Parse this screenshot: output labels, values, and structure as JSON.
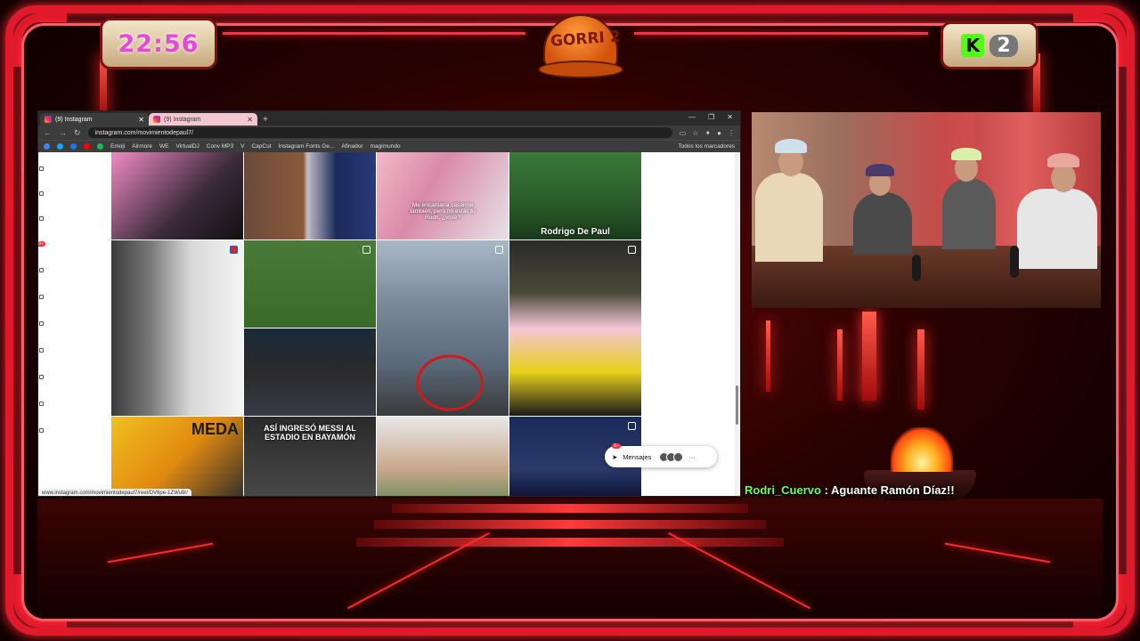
{
  "overlay": {
    "clock": "22:56",
    "viewer_count": "2",
    "kick_logo_letter": "K",
    "logo_text": "GORRI 2",
    "accent_color": "#e01a2a",
    "clock_color": "#e24bd6",
    "kick_color": "#53fc18"
  },
  "browser": {
    "tabs": [
      {
        "label": "(9) Instagram",
        "close": "✕"
      },
      {
        "label": "(9) Instagram",
        "close": "✕"
      }
    ],
    "new_tab": "+",
    "url": "instagram.com/movimientodepaul7/",
    "bookmarks": [
      "Emoji",
      "Airmore",
      "WE",
      "VirtualDJ",
      "Conv MP3",
      "V",
      "CapCut",
      "Instagram Fonts Ge...",
      "Afinador",
      "magimundo",
      "Todos los marcadores"
    ],
    "status_url": "www.instagram.com/movimientodepaul7/reel/DV6pe-1ZWu9r/"
  },
  "instagram": {
    "notification_count": "9+",
    "grid_captions": {
      "post_text_1": "Me encantaría casarme también, pero no estás tú Rodri, ¿viste?",
      "post_name": "Rodrigo De Paul",
      "post_stadium": "ASÍ INGRESÓ MESSI AL ESTADIO EN BAYAMÓN",
      "post_medal": "MEDA"
    },
    "messages": {
      "label": "Mensajes",
      "badge": "9+"
    }
  },
  "chat": {
    "user": "Rodri_Cuervo",
    "separator": " : ",
    "message": "Aguante Ramón Díaz!!",
    "user_color": "#6cff57"
  }
}
